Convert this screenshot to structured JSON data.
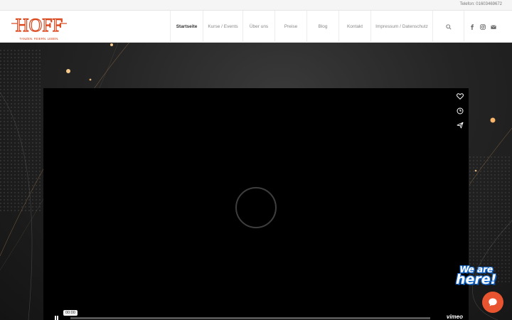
{
  "topbar": {
    "phone": "Telefon: 01603469672"
  },
  "logo": {
    "brand": "HOFF",
    "tagline": "TANZEN. FEIERN. LEBEN."
  },
  "nav": {
    "items": [
      {
        "label": "Startseite",
        "active": true
      },
      {
        "label": "Kurse / Events"
      },
      {
        "label": "Über uns"
      },
      {
        "label": "Preise"
      },
      {
        "label": "Blog"
      },
      {
        "label": "Kontakt"
      },
      {
        "label": "Impressum / Datenschutz"
      }
    ],
    "search_icon": "search-icon"
  },
  "social": [
    "facebook-icon",
    "instagram-icon",
    "mail-icon"
  ],
  "player": {
    "side_icons": [
      "heart-icon",
      "clock-icon",
      "send-icon"
    ],
    "time": "00:00",
    "brand": "vimeo"
  },
  "chat": {
    "badge_line1": "We are",
    "badge_line2": "here!"
  },
  "colors": {
    "brand": "#d9461c",
    "chat": "#e8542f"
  }
}
